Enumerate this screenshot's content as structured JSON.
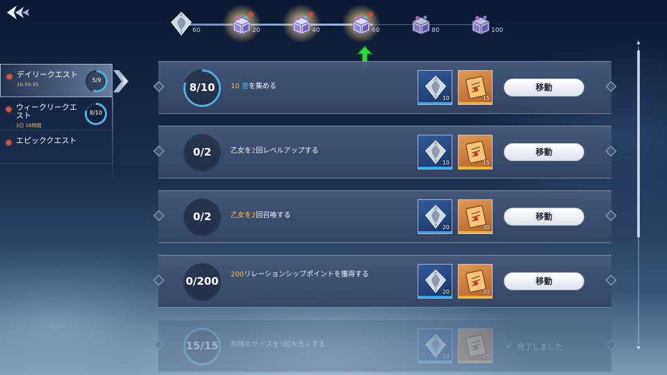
{
  "progress": {
    "milestones": [
      {
        "label": "60",
        "reward": "crystal-icon",
        "reached": true,
        "notify": false
      },
      {
        "label": "20",
        "reward": "chest-icon",
        "reached": true,
        "notify": true
      },
      {
        "label": "40",
        "reward": "chest-icon",
        "reached": true,
        "notify": true
      },
      {
        "label": "60",
        "reward": "chest-icon",
        "reached": true,
        "notify": true
      },
      {
        "label": "80",
        "reward": "chest-icon",
        "reached": false,
        "notify": false
      },
      {
        "label": "100",
        "reward": "chest-icon",
        "reached": false,
        "notify": false
      }
    ],
    "current_marker": "arrow-up-icon",
    "marker_color": "#28e23b"
  },
  "sidebar": {
    "items": [
      {
        "label": "デイリークエスト",
        "timer": "16:59:35",
        "progress": "5/9",
        "fraction": 0.556,
        "active": true
      },
      {
        "label": "ウィークリークエスト",
        "timer": "3日 16時間",
        "progress": "8/10",
        "fraction": 0.8,
        "active": false
      },
      {
        "label": "エピッククエスト",
        "timer": "",
        "progress": "",
        "fraction": 0,
        "active": false
      }
    ]
  },
  "quests": [
    {
      "progress": "8/10",
      "fraction": 0.8,
      "desc": [
        {
          "t": "10 ",
          "hl": true
        },
        {
          "t": "書",
          "hl": "blue"
        },
        {
          "t": "を集める",
          "hl": false
        }
      ],
      "rewards": [
        "10",
        "15"
      ],
      "button": "移動",
      "done": false
    },
    {
      "progress": "0/2",
      "fraction": 0,
      "desc": [
        {
          "t": "乙女を",
          "hl": false
        },
        {
          "t": "2",
          "hl": true
        },
        {
          "t": "回レベルアップする",
          "hl": false
        }
      ],
      "rewards": [
        "10",
        "15"
      ],
      "button": "移動",
      "done": false
    },
    {
      "progress": "0/2",
      "fraction": 0,
      "desc": [
        {
          "t": "乙女を",
          "hl": true
        },
        {
          "t": "2",
          "hl": true
        },
        {
          "t": "回召喚する",
          "hl": false
        }
      ],
      "rewards": [
        "20",
        "30"
      ],
      "button": "移動",
      "done": false
    },
    {
      "progress": "0/200",
      "fraction": 0,
      "desc": [
        {
          "t": "200",
          "hl": true
        },
        {
          "t": "リレーションシップポイントを獲得する",
          "hl": false
        }
      ],
      "rewards": [
        "20",
        "30"
      ],
      "button": "移動",
      "done": false
    },
    {
      "progress": "15/15",
      "fraction": 1,
      "desc": [
        {
          "t": "部隊のサイズを",
          "hl": false
        },
        {
          "t": "5",
          "hl": true
        },
        {
          "t": "回大きくする",
          "hl": false
        }
      ],
      "rewards": [
        "10",
        "15"
      ],
      "button": "完了しました",
      "done": true
    }
  ],
  "colors": {
    "timer": "#f2c35a",
    "highlight": "#f6c24e",
    "ring_fill": "#4fb0e6",
    "ring_track": "#2a3550"
  }
}
